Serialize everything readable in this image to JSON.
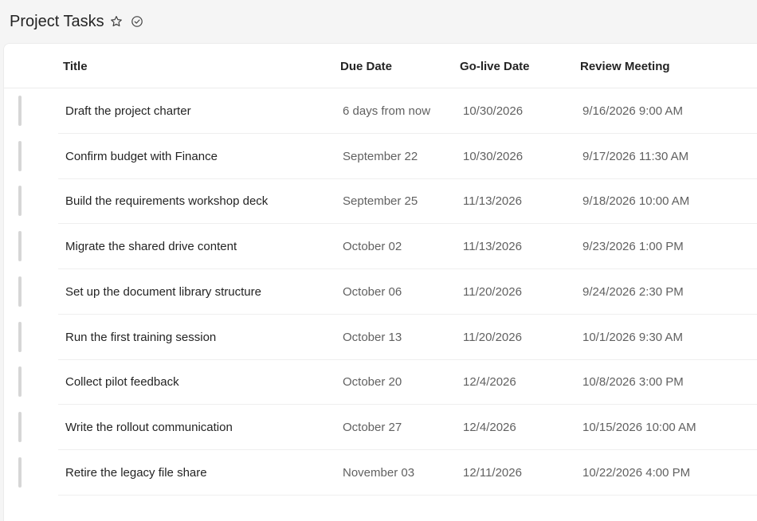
{
  "header": {
    "title": "Project Tasks",
    "favorite_icon": "star-outline-icon",
    "status_icon": "check-circle-icon"
  },
  "table": {
    "columns": [
      "Title",
      "Due Date",
      "Go-live Date",
      "Review Meeting"
    ],
    "rows": [
      [
        "Draft the project charter",
        "6 days from now",
        "10/30/2026",
        "9/16/2026 9:00 AM"
      ],
      [
        "Confirm budget with Finance",
        "September 22",
        "10/30/2026",
        "9/17/2026 11:30 AM"
      ],
      [
        "Build the requirements workshop deck",
        "September 25",
        "11/13/2026",
        "9/18/2026 10:00 AM"
      ],
      [
        "Migrate the shared drive content",
        "October 02",
        "11/13/2026",
        "9/23/2026 1:00 PM"
      ],
      [
        "Set up the document library structure",
        "October 06",
        "11/20/2026",
        "9/24/2026 2:30 PM"
      ],
      [
        "Run the first training session",
        "October 13",
        "11/20/2026",
        "10/1/2026 9:30 AM"
      ],
      [
        "Collect pilot feedback",
        "October 20",
        "12/4/2026",
        "10/8/2026 3:00 PM"
      ],
      [
        "Write the rollout communication",
        "October 27",
        "12/4/2026",
        "10/15/2026 10:00 AM"
      ],
      [
        "Retire the legacy file share",
        "November 03",
        "12/11/2026",
        "10/22/2026 4:00 PM"
      ]
    ]
  },
  "colors": {
    "background": "#f5f5f5",
    "card": "#ffffff",
    "text_primary": "#242424",
    "text_secondary": "#616161",
    "row_handle": "#d6d6d6"
  }
}
